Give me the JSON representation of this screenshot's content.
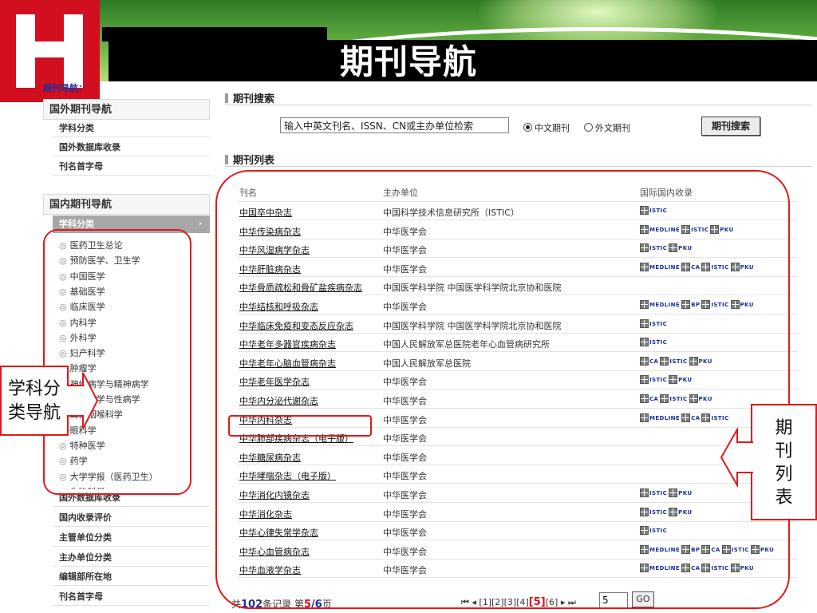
{
  "page": {
    "title": "期刊导航"
  },
  "sidebar": {
    "crumb": "期刊导航：",
    "foreign_head": "国外期刊导航",
    "foreign_items": [
      "学科分类",
      "国外数据库收录",
      "刊名首字母"
    ],
    "domestic_head": "国内期刊导航",
    "active_category": "学科分类",
    "subjects": [
      "医药卫生总论",
      "预防医学、卫生学",
      "中国医学",
      "基础医学",
      "临床医学",
      "内科学",
      "外科学",
      "妇产科学",
      "肿瘤学",
      "神经病学与精神病学",
      "皮肤病学与性病学",
      "耳鼻咽喉科学",
      "眼科学",
      "特种医学",
      "药学",
      "大学学报（医药卫生）",
      "生物科学"
    ],
    "domestic_items": [
      "国外数据库收录",
      "国内收录评价",
      "主管单位分类",
      "主办单位分类",
      "编辑部所在地",
      "刊名首字母"
    ]
  },
  "search": {
    "section_title": "期刊搜索",
    "input_value": "输入中英文刊名、ISSN、CN或主办单位检索",
    "radio_cn": "中文期刊",
    "radio_en": "外文期刊",
    "button": "期刊搜索"
  },
  "list": {
    "section_title": "期刊列表",
    "col_name": "刊名",
    "col_org": "主办单位",
    "col_index": "国际国内收录",
    "rows": [
      {
        "name": "中国卒中杂志",
        "org": "中国科学技术信息研究所（ISTIC）",
        "indexes": [
          "ISTIC"
        ]
      },
      {
        "name": "中华传染病杂志",
        "org": "中华医学会",
        "indexes": [
          "MEDLINE",
          "ISTIC",
          "PKU"
        ]
      },
      {
        "name": "中华风湿病学杂志",
        "org": "中华医学会",
        "indexes": [
          "ISTIC",
          "PKU"
        ]
      },
      {
        "name": "中华肝脏病杂志",
        "org": "中华医学会",
        "indexes": [
          "MEDLINE",
          "CA",
          "ISTIC",
          "PKU"
        ]
      },
      {
        "name": "中华骨质疏松和骨矿盐疾病杂志",
        "org": "中国医学科学院  中国医学科学院北京协和医院",
        "indexes": []
      },
      {
        "name": "中华结核和呼吸杂志",
        "org": "中华医学会",
        "indexes": [
          "MEDLINE",
          "BP",
          "ISTIC",
          "PKU"
        ]
      },
      {
        "name": "中华临床免疫和变态反应杂志",
        "org": "中国医学科学院   中国医学科学院北京协和医院",
        "indexes": [
          "ISTIC"
        ]
      },
      {
        "name": "中华老年多器官疾病杂志",
        "org": "中国人民解放军总医院老年心血管病研究所",
        "indexes": [
          "ISTIC"
        ]
      },
      {
        "name": "中华老年心脑血管病杂志",
        "org": "中国人民解放军总医院",
        "indexes": [
          "CA",
          "ISTIC",
          "PKU"
        ]
      },
      {
        "name": "中华老年医学杂志",
        "org": "中华医学会",
        "indexes": [
          "ISTIC",
          "PKU"
        ]
      },
      {
        "name": "中华内分泌代谢杂志",
        "org": "中华医学会",
        "indexes": [
          "CA",
          "ISTIC",
          "PKU"
        ]
      },
      {
        "name": "中华内科杂志",
        "org": "中华医学会",
        "indexes": [
          "MEDLINE",
          "CA",
          "ISTIC"
        ]
      },
      {
        "name": "中华肺部疾病杂志（电子版）",
        "org": "中华医学会",
        "indexes": []
      },
      {
        "name": "中华糖尿病杂志",
        "org": "中华医学会",
        "indexes": []
      },
      {
        "name": "中华哮喘杂志（电子版）",
        "org": "中华医学会",
        "indexes": []
      },
      {
        "name": "中华消化内镜杂志",
        "org": "中华医学会",
        "indexes": [
          "ISTIC",
          "PKU"
        ]
      },
      {
        "name": "中华消化杂志",
        "org": "中华医学会",
        "indexes": [
          "ISTIC",
          "PKU"
        ]
      },
      {
        "name": "中华心律失常学杂志",
        "org": "中华医学会",
        "indexes": [
          "ISTIC"
        ]
      },
      {
        "name": "中华心血管病杂志",
        "org": "中华医学会",
        "indexes": [
          "MEDLINE",
          "BP",
          "CA",
          "ISTIC",
          "PKU"
        ]
      },
      {
        "name": "中华血液学杂志",
        "org": "中华医学会",
        "indexes": [
          "MEDLINE",
          "CA",
          "ISTIC",
          "PKU"
        ]
      }
    ]
  },
  "footer": {
    "total_prefix": "共",
    "total_count": "102",
    "total_mid": "条记录   第",
    "current_page": "5",
    "slash": "/",
    "total_pages": "6",
    "total_suffix": "页",
    "first_prev": "⏮ ◂",
    "pages": [
      "[1]",
      "[2]",
      "[3]",
      "[4]",
      "[5]",
      "[6]"
    ],
    "next_last": "▸ ⏭",
    "page_input": "5",
    "go": "GO"
  },
  "annotations": {
    "left_label": "学科分类导航",
    "right_label": "期刊列表"
  },
  "colors": {
    "annotation_red": "#e11a1a",
    "link_blue": "#1a2f9a",
    "logo_red": "#d10f1f"
  }
}
